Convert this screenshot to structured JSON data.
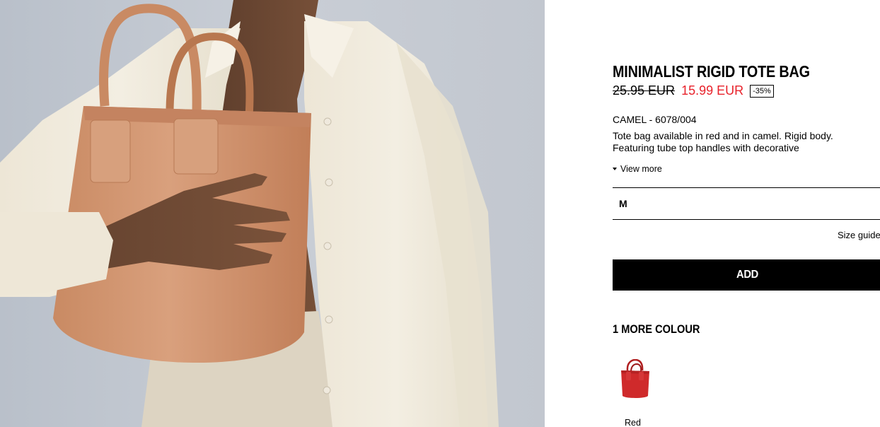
{
  "product": {
    "title": "MINIMALIST RIGID TOTE BAG",
    "old_price": "25.95 EUR",
    "new_price": "15.99 EUR",
    "discount": "-35%",
    "colour_code": "CAMEL - 6078/004",
    "description": "Tote bag available in red and in camel. Rigid body. Featuring tube top handles with decorative",
    "view_more": "View more"
  },
  "size_selector": {
    "value": "M"
  },
  "size_guide": "Size guide",
  "add_button": "ADD",
  "more_colours": {
    "heading": "1 MORE COLOUR",
    "items": [
      {
        "label": "Red"
      }
    ]
  },
  "colors": {
    "price_sale": "#e8222b",
    "button_bg": "#000000",
    "bag_camel": "#d39a76",
    "bag_red": "#cf2a2b"
  }
}
